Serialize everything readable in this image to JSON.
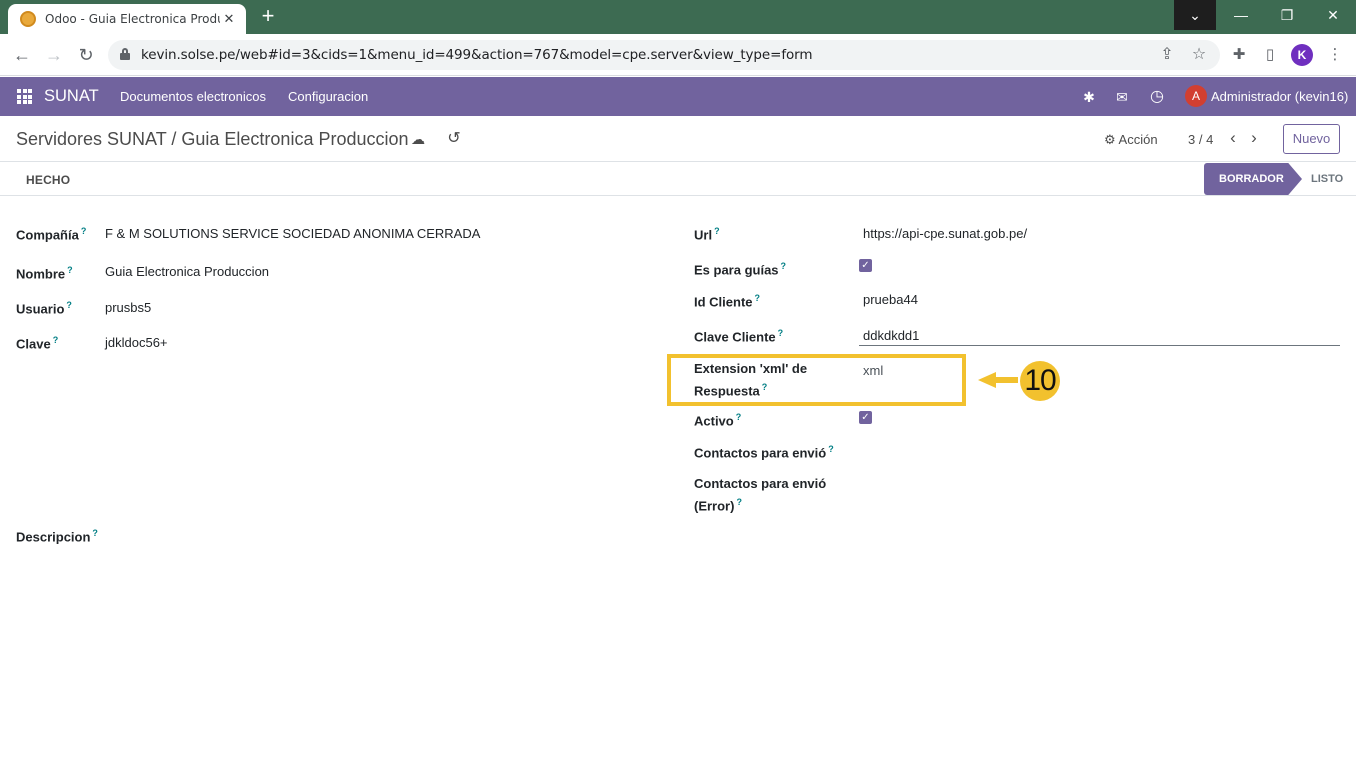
{
  "browser": {
    "tab_title": "Odoo - Guia Electronica Produc",
    "tab_close": "✕",
    "new_tab": "+",
    "url": "kevin.solse.pe/web#id=3&cids=1&menu_id=499&action=767&model=cpe.server&view_type=form",
    "profile_initial": "K",
    "window_controls": {
      "dropdown": "⌄",
      "minimize": "—",
      "maximize": "❐",
      "close": "✕"
    },
    "nav": {
      "back": "←",
      "forward": "→",
      "reload": "↻"
    },
    "icons": {
      "share": "⇪",
      "star": "☆",
      "extensions": "✚",
      "sidepanel": "▯",
      "menu": "⋮"
    }
  },
  "navbar": {
    "brand": "SUNAT",
    "menus": [
      "Documentos electronicos",
      "Configuracion"
    ],
    "icons": {
      "debug": "✱",
      "chat": "✉",
      "activity": "◷"
    },
    "user_initial": "A",
    "user_name": "Administrador (kevin16)",
    "color": "#71639e"
  },
  "control_panel": {
    "breadcrumb": "Servidores SUNAT / Guia Electronica Produccion",
    "save_icon": "☁",
    "discard_icon": "↺",
    "action_label": "⚙ Acción",
    "pager": "3 / 4",
    "prev": "‹",
    "next": "›",
    "new_label": "Nuevo"
  },
  "statusbar": {
    "button": "HECHO",
    "stages": {
      "active": "BORRADOR",
      "next": "LISTO"
    }
  },
  "form": {
    "help_mark": "?",
    "left": {
      "company": {
        "label": "Compañía",
        "value": "F & M SOLUTIONS SERVICE SOCIEDAD ANONIMA CERRADA"
      },
      "name": {
        "label": "Nombre",
        "value": "Guia Electronica Produccion"
      },
      "user": {
        "label": "Usuario",
        "value": "prusbs5"
      },
      "password": {
        "label": "Clave",
        "value": "jdkldoc56+"
      },
      "description": {
        "label": "Descripcion"
      }
    },
    "right": {
      "url": {
        "label": "Url",
        "value": "https://api-cpe.sunat.gob.pe/"
      },
      "for_guides": {
        "label": "Es para guías",
        "checked": true
      },
      "client_id": {
        "label": "Id Cliente",
        "value": "prueba44"
      },
      "client_secret": {
        "label": "Clave Cliente",
        "value": "ddkdkdd1"
      },
      "xml_extension": {
        "label_line1": "Extension 'xml' de",
        "label_line2": "Respuesta",
        "value": "xml"
      },
      "active": {
        "label": "Activo",
        "checked": true
      },
      "contacts": {
        "label": "Contactos para envió"
      },
      "contacts_error": {
        "label_line1": "Contactos para envió",
        "label_line2": "(Error)"
      }
    }
  },
  "annotation": {
    "step_number": "10",
    "color": "#f2c12e"
  }
}
